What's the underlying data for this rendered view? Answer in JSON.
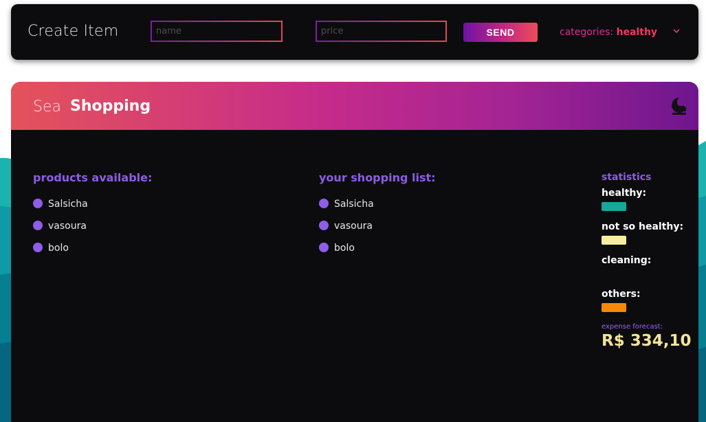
{
  "topbar": {
    "title": "Create Item",
    "name_placeholder": "name",
    "price_placeholder": "price",
    "send_label": "SEND",
    "category_label": "categories:",
    "category_value": "healthy"
  },
  "header": {
    "brand_light": "Sea",
    "brand_bold": "Shopping",
    "theme_icon": "moon-icon"
  },
  "products": {
    "title": "products available:",
    "items": [
      "Salsicha",
      "vasoura",
      "bolo"
    ]
  },
  "shopping_list": {
    "title": "your shopping list:",
    "items": [
      "Salsicha",
      "vasoura",
      "bolo"
    ]
  },
  "statistics": {
    "title": "statistics",
    "categories": [
      {
        "label": "healthy:",
        "color": "#14a99b",
        "shown": true
      },
      {
        "label": "not so healthy:",
        "color": "#f7eda0",
        "shown": true
      },
      {
        "label": "cleaning:",
        "color": "#0c0c0e",
        "shown": false
      },
      {
        "label": "others:",
        "color": "#f5890a",
        "shown": true
      }
    ],
    "forecast_label": "expense forecast:",
    "forecast_value": "R$ 334,10"
  },
  "colors": {
    "accent_purple": "#8f5de8",
    "header_gradient_start": "#e4535a",
    "header_gradient_end": "#6e168e",
    "panel_bg": "#0c0c0e"
  }
}
